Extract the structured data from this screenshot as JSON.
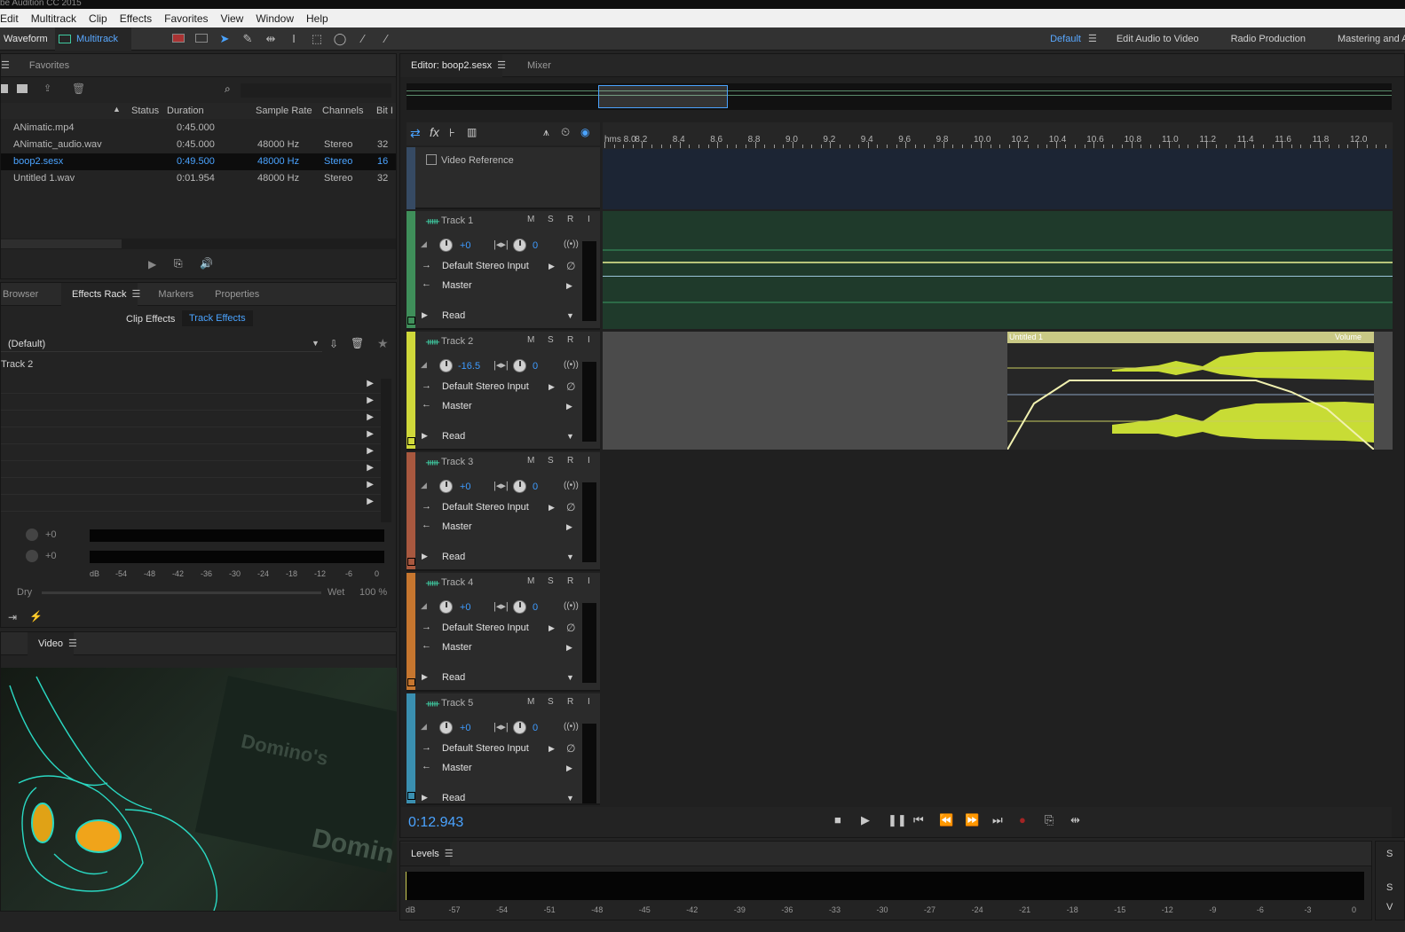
{
  "app": {
    "title": "be Audition CC 2015"
  },
  "menu": [
    "Edit",
    "Multitrack",
    "Clip",
    "Effects",
    "Favorites",
    "View",
    "Window",
    "Help"
  ],
  "toolbar": {
    "waveform_label": "Waveform",
    "multitrack_label": "Multitrack"
  },
  "workspaces": [
    "Default",
    "Edit Audio to Video",
    "Radio Production",
    "Mastering and Analysis"
  ],
  "files_panel": {
    "tab": "Favorites",
    "columns": [
      "Status",
      "Duration",
      "Sample Rate",
      "Channels",
      "Bit I"
    ],
    "rows": [
      {
        "name": "ANimatic.mp4",
        "duration": "0:45.000",
        "rate": "",
        "channels": "",
        "bits": ""
      },
      {
        "name": "ANimatic_audio.wav",
        "duration": "0:45.000",
        "rate": "48000 Hz",
        "channels": "Stereo",
        "bits": "32"
      },
      {
        "name": "boop2.sesx",
        "duration": "0:49.500",
        "rate": "48000 Hz",
        "channels": "Stereo",
        "bits": "16"
      },
      {
        "name": "Untitled 1.wav",
        "duration": "0:01.954",
        "rate": "48000 Hz",
        "channels": "Stereo",
        "bits": "32"
      }
    ]
  },
  "effects_panel": {
    "tabs": [
      "Browser",
      "Effects Rack",
      "Markers",
      "Properties"
    ],
    "clip_effects": "Clip Effects",
    "track_effects": "Track Effects",
    "preset": "(Default)",
    "track": "Track 2",
    "input_val": "+0",
    "output_val": "+0",
    "db_scale": [
      "dB",
      "-54",
      "-48",
      "-42",
      "-36",
      "-30",
      "-24",
      "-18",
      "-12",
      "-6",
      "0"
    ],
    "dry": "Dry",
    "wet": "Wet",
    "mix": "100 %"
  },
  "video_panel": {
    "tab": "Video"
  },
  "editor": {
    "tab": "Editor: boop2.sesx",
    "mixer_tab": "Mixer",
    "ruler": [
      "hms 8.0",
      "8.2",
      "8.4",
      "8.6",
      "8.8",
      "9.0",
      "9.2",
      "9.4",
      "9.6",
      "9.8",
      "10.0",
      "10.2",
      "10.4",
      "10.6",
      "10.8",
      "11.0",
      "11.2",
      "11.4",
      "11.6",
      "11.8",
      "12.0"
    ],
    "video_ref": "Video Reference",
    "clip_name": "Untitled 1",
    "clip_menu": "Volume",
    "time": "0:12.943"
  },
  "tracks": [
    {
      "name": "Track 1",
      "vol": "+0",
      "pan": "0",
      "input": "Default Stereo Input",
      "output": "Master",
      "mode": "Read",
      "color": "#3f8f5a"
    },
    {
      "name": "Track 2",
      "vol": "-16.5",
      "pan": "0",
      "input": "Default Stereo Input",
      "output": "Master",
      "mode": "Read",
      "color": "#cfd83a"
    },
    {
      "name": "Track 3",
      "vol": "+0",
      "pan": "0",
      "input": "Default Stereo Input",
      "output": "Master",
      "mode": "Read",
      "color": "#a8583f"
    },
    {
      "name": "Track 4",
      "vol": "+0",
      "pan": "0",
      "input": "Default Stereo Input",
      "output": "Master",
      "mode": "Read",
      "color": "#c6762f"
    },
    {
      "name": "Track 5",
      "vol": "+0",
      "pan": "0",
      "input": "Default Stereo Input",
      "output": "Master",
      "mode": "Read",
      "color": "#3a8fb0"
    }
  ],
  "track_buttons": {
    "m": "M",
    "s": "S",
    "r": "R",
    "i": "I"
  },
  "levels": {
    "title": "Levels",
    "scale": [
      "dB",
      "-57",
      "-54",
      "-51",
      "-48",
      "-45",
      "-42",
      "-39",
      "-36",
      "-33",
      "-30",
      "-27",
      "-24",
      "-21",
      "-18",
      "-15",
      "-12",
      "-9",
      "-6",
      "-3",
      "0"
    ]
  },
  "side_letters": [
    "S",
    "S",
    "V"
  ],
  "video_text": [
    "Domino's",
    "Domin"
  ]
}
